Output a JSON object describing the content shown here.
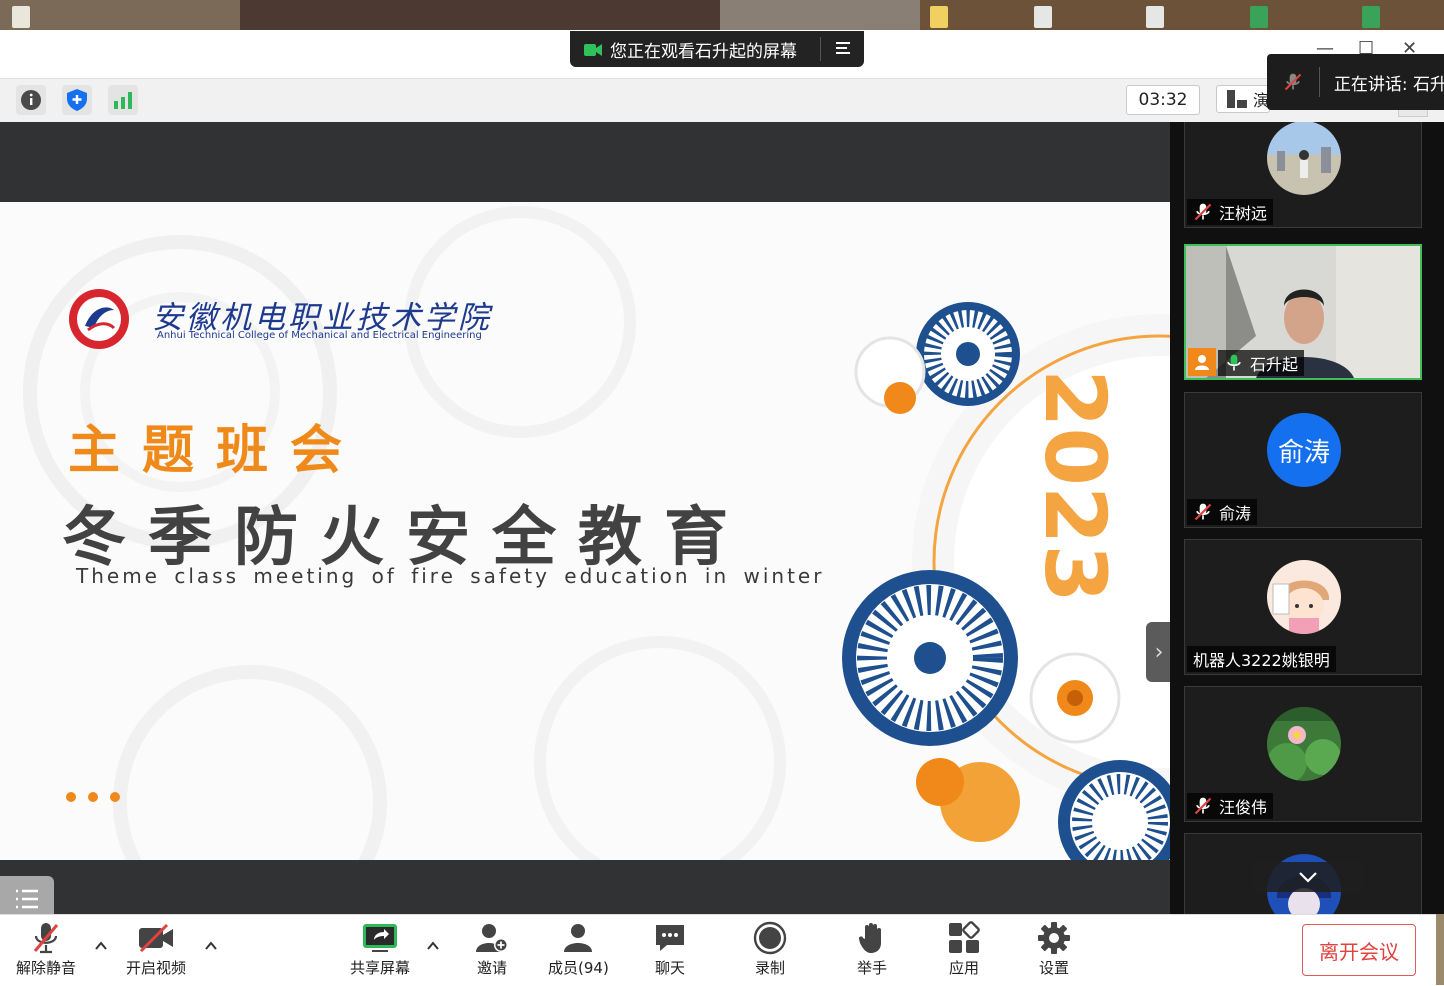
{
  "share_banner": {
    "text": "您正在观看石升起的屏幕"
  },
  "toolbar": {
    "timer": "03:32",
    "view_label": "演"
  },
  "active_speaker": {
    "label": "正在讲话: 石升"
  },
  "slide": {
    "school_cn": "安徽机电职业技术学院",
    "school_en": "Anhui Technical College of Mechanical and Electrical Engineering",
    "theme": "主题班会",
    "title_cn": "冬季防火安全教育",
    "title_en": "Theme class meeting of fire safety education in winter",
    "year": "2023"
  },
  "participants": [
    {
      "name": "汪树远",
      "muted": true,
      "avatar": "photo"
    },
    {
      "name": "石升起",
      "muted": false,
      "avatar": "video",
      "active": true
    },
    {
      "name": "俞涛",
      "muted": true,
      "avatar": "initials",
      "initials": "俞涛",
      "avatar_color": "#1570ef"
    },
    {
      "name": "机器人3222姚银明",
      "muted": null,
      "avatar": "cartoon"
    },
    {
      "name": "汪俊伟",
      "muted": true,
      "avatar": "lotus"
    },
    {
      "name": "",
      "muted": null,
      "avatar": "blue-anime"
    }
  ],
  "controls": {
    "unmute": "解除静音",
    "start_video": "开启视频",
    "share_screen": "共享屏幕",
    "invite": "邀请",
    "participants": "成员(94)",
    "chat": "聊天",
    "record": "录制",
    "raise_hand": "举手",
    "apps": "应用",
    "settings": "设置",
    "leave": "离开会议"
  },
  "colors": {
    "accent_green": "#3fbf5a",
    "leave_red": "#e0433f",
    "brand_orange": "#ef8a1a",
    "school_blue": "#1e3a8f"
  }
}
